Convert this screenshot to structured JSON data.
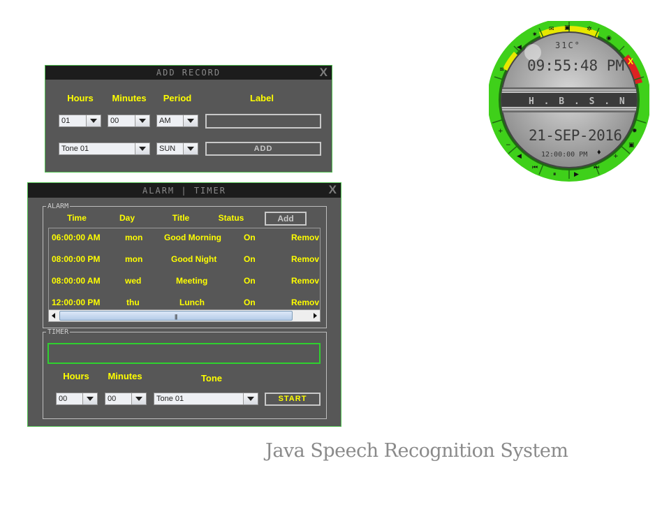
{
  "add_record": {
    "title": "ADD RECORD",
    "close": "X",
    "labels": {
      "hours": "Hours",
      "minutes": "Minutes",
      "period": "Period",
      "label": "Label"
    },
    "hours_value": "01",
    "minutes_value": "00",
    "period_value": "AM",
    "label_value": "",
    "tone_value": "Tone 01",
    "day_value": "SUN",
    "add_button": "ADD"
  },
  "alarm_timer": {
    "title": "ALARM | TIMER",
    "close": "X",
    "alarm_group": "ALARM",
    "columns": {
      "time": "Time",
      "day": "Day",
      "title": "Title",
      "status": "Status"
    },
    "add_button": "Add",
    "rows": [
      {
        "time": "06:00:00 AM",
        "day": "mon",
        "title": "Good Morning",
        "status": "On",
        "action": "Remov"
      },
      {
        "time": "08:00:00 PM",
        "day": "mon",
        "title": "Good Night",
        "status": "On",
        "action": "Remov"
      },
      {
        "time": "08:00:00 AM",
        "day": "wed",
        "title": "Meeting",
        "status": "On",
        "action": "Remov"
      },
      {
        "time": "12:00:00 PM",
        "day": "thu",
        "title": "Lunch",
        "status": "On",
        "action": "Remov"
      }
    ],
    "scroll_grip": "|||",
    "timer_group": "TIMER",
    "timer_display": "",
    "timer_labels": {
      "hours": "Hours",
      "minutes": "Minutes",
      "tone": "Tone"
    },
    "timer_hours": "00",
    "timer_minutes": "00",
    "timer_tone": "Tone 01",
    "start_button": "START"
  },
  "clock": {
    "temperature": "31C°",
    "time": "09:55:48 PM",
    "name": "H . B . S . N",
    "date": "21-SEP-2016",
    "alarm_time": "12:00:00 PM",
    "close": "X",
    "ring_color": "#33cc00",
    "accent_yellow": "#ffff00",
    "close_color": "#dd2222"
  },
  "caption": "Java Speech Recognition System",
  "colors": {
    "window_bg": "#575757",
    "titlebar_bg": "#1c1c1c",
    "label_yellow": "#ffff00",
    "frame_green": "#5ac85a"
  }
}
